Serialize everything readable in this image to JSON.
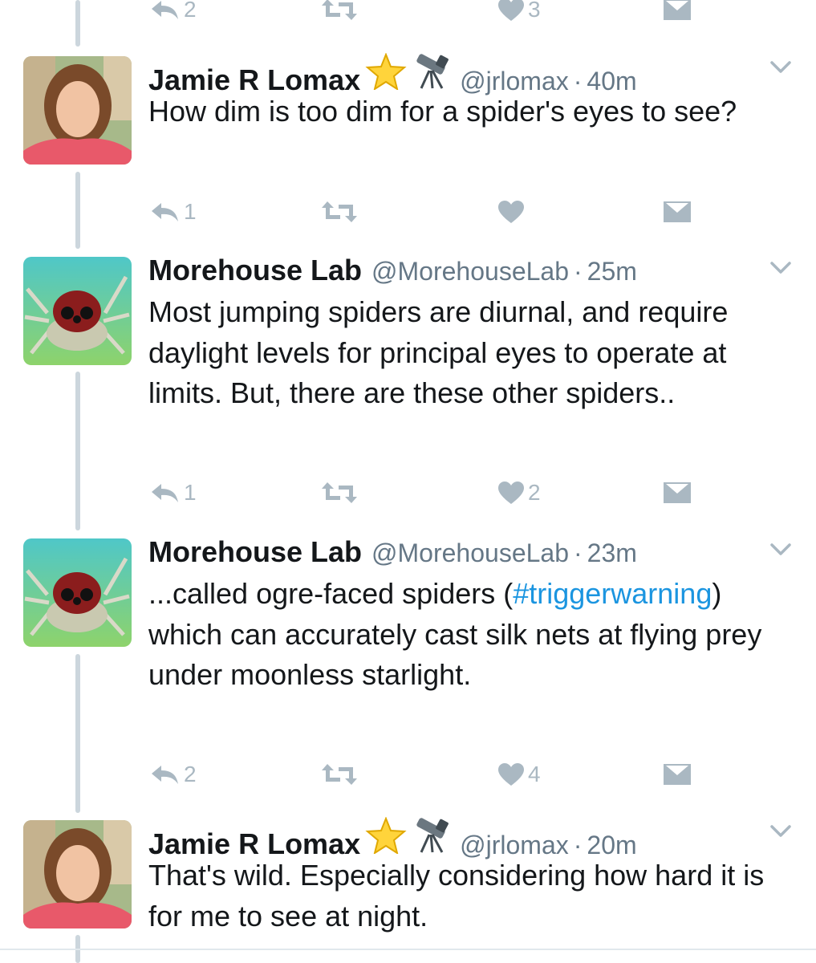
{
  "top_actions": {
    "reply_count": "2",
    "like_count": "3"
  },
  "tweets": [
    {
      "name": "Jamie R Lomax",
      "handle": "@jrlomax",
      "time": "40m",
      "text": "How dim is too dim for a spider's eyes to see?",
      "reply_count": "1",
      "like_count": ""
    },
    {
      "name": "Morehouse Lab",
      "handle": "@MorehouseLab",
      "time": "25m",
      "text": "Most jumping spiders are diurnal, and require daylight levels for principal eyes to operate at limits. But, there are these other spiders..",
      "reply_count": "1",
      "like_count": "2"
    },
    {
      "name": "Morehouse Lab",
      "handle": "@MorehouseLab",
      "time": "23m",
      "text_before": "...called ogre-faced spiders (",
      "hashtag": "#triggerwarning",
      "text_after": ") which can accurately cast silk nets at flying prey under moonless starlight.",
      "reply_count": "2",
      "like_count": "4"
    },
    {
      "name": "Jamie R Lomax",
      "handle": "@jrlomax",
      "time": "20m",
      "text": "That's wild. Especially considering how hard it is for me to see at night."
    }
  ],
  "separator": "·",
  "icons": [
    "reply-icon",
    "retweet-icon",
    "like-icon",
    "dm-icon",
    "chevron-down-icon",
    "star-emoji-icon",
    "telescope-emoji-icon"
  ],
  "colors": {
    "action_gray": "#aab8c2",
    "link_blue": "#1b95e0",
    "thread_line": "#ccd6dd",
    "handle_gray": "#657786"
  }
}
